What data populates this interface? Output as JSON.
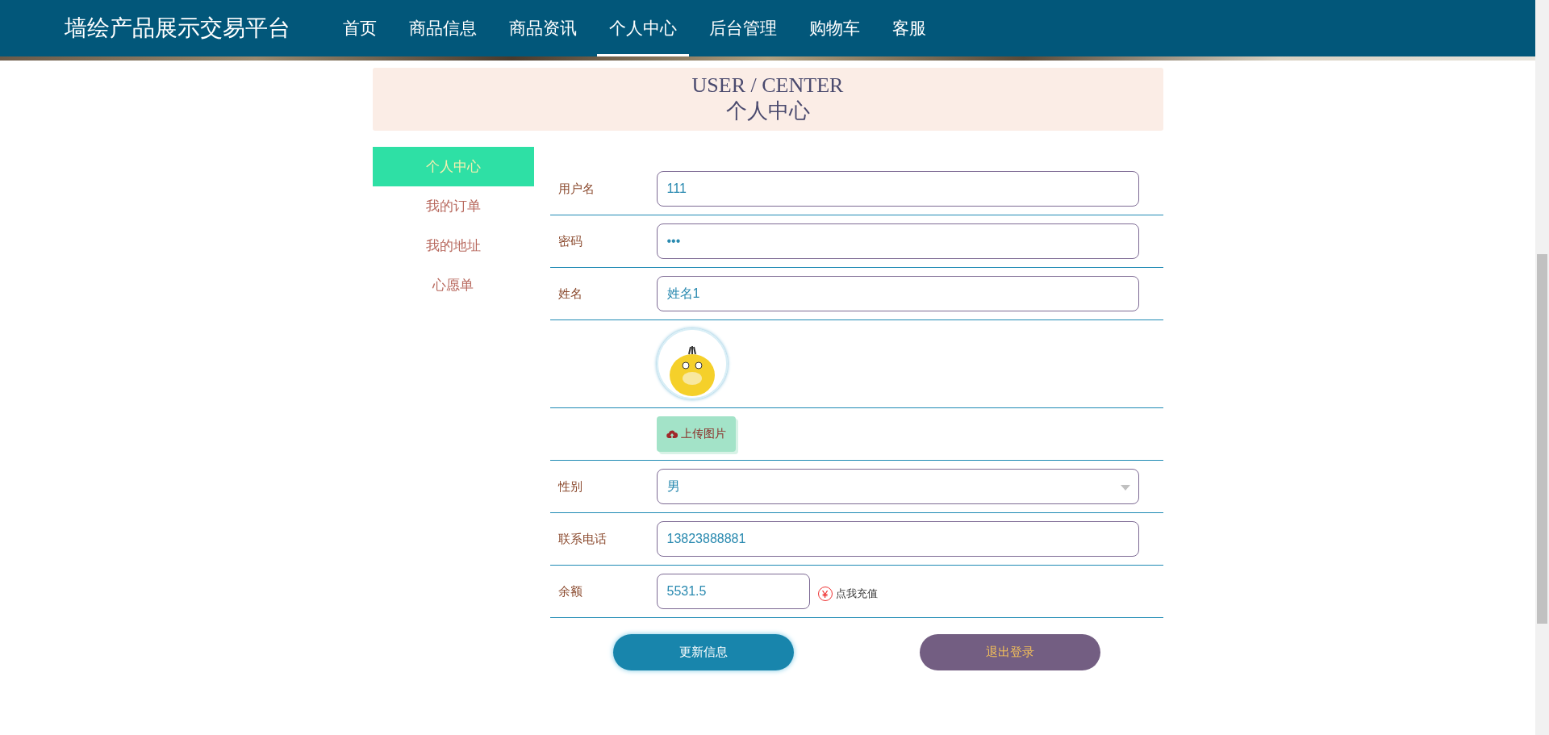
{
  "header": {
    "brand": "墙绘产品展示交易平台",
    "nav": [
      {
        "label": "首页",
        "selected": false
      },
      {
        "label": "商品信息",
        "selected": false
      },
      {
        "label": "商品资讯",
        "selected": false
      },
      {
        "label": "个人中心",
        "selected": true
      },
      {
        "label": "后台管理",
        "selected": false
      },
      {
        "label": "购物车",
        "selected": false
      },
      {
        "label": "客服",
        "selected": false
      }
    ]
  },
  "banner": {
    "title_en": "USER / CENTER",
    "title_cn": "个人中心"
  },
  "sidebar": {
    "items": [
      {
        "label": "个人中心",
        "selected": true
      },
      {
        "label": "我的订单",
        "selected": false
      },
      {
        "label": "我的地址",
        "selected": false
      },
      {
        "label": "心愿单",
        "selected": false
      }
    ]
  },
  "form": {
    "fields": [
      {
        "kind": "text",
        "label": "用户名",
        "value": "111"
      },
      {
        "kind": "text",
        "label": "密码",
        "value": "•••"
      },
      {
        "kind": "text",
        "label": "姓名",
        "value": "姓名1"
      },
      {
        "kind": "avatar"
      },
      {
        "kind": "upload",
        "button": "上传图片"
      },
      {
        "kind": "select",
        "label": "性别",
        "value": "男"
      },
      {
        "kind": "text",
        "label": "联系电话",
        "value": "13823888881"
      },
      {
        "kind": "balance",
        "label": "余额",
        "value": "5531.5",
        "action_icon": "¥",
        "action": "点我充值"
      }
    ],
    "buttons": [
      {
        "kind": "primary",
        "label": "更新信息"
      },
      {
        "kind": "secondary",
        "label": "退出登录"
      }
    ]
  }
}
